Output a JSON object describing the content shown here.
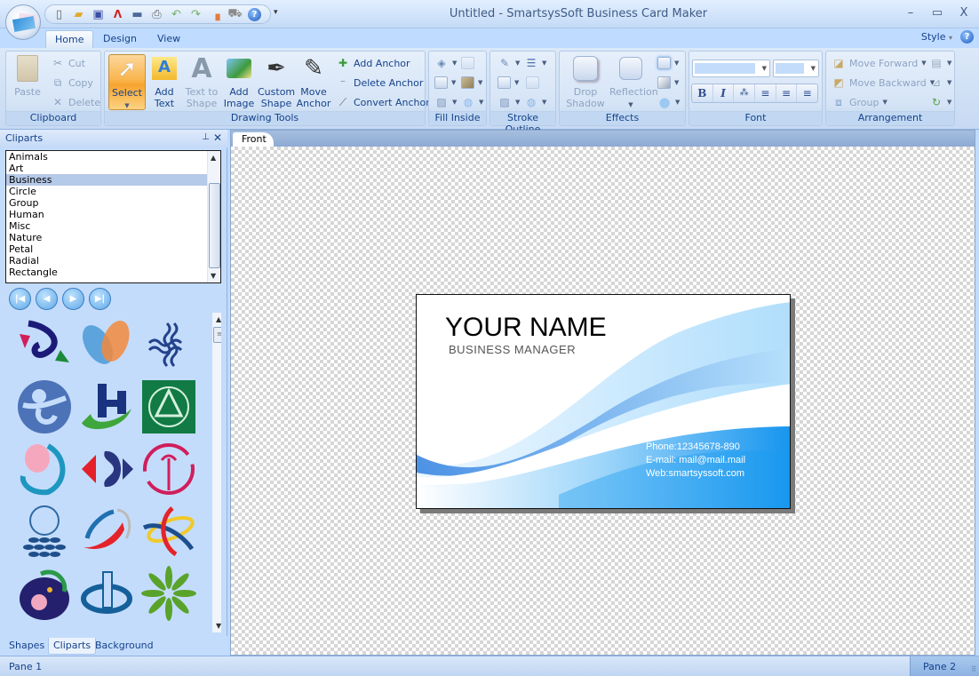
{
  "window": {
    "title": "Untitled - SmartsysSoft Business Card Maker",
    "minimize": "–",
    "maximize": "▭",
    "close": "X"
  },
  "quick_access": [
    {
      "name": "new-document-icon",
      "glyph": "🗋"
    },
    {
      "name": "open-folder-icon",
      "glyph": "📂"
    },
    {
      "name": "save-icon",
      "glyph": "💾"
    },
    {
      "name": "pdf-icon",
      "glyph": "📄"
    },
    {
      "name": "image-export-icon",
      "glyph": "🖼"
    },
    {
      "name": "print-icon",
      "glyph": "🖨"
    },
    {
      "name": "undo-icon",
      "glyph": "↶"
    },
    {
      "name": "redo-icon",
      "glyph": "↷"
    },
    {
      "name": "eraser-icon",
      "glyph": "▴"
    },
    {
      "name": "cart-icon",
      "glyph": "🛒"
    },
    {
      "name": "help-icon",
      "glyph": "?"
    }
  ],
  "qat_more": "▾",
  "tabs": [
    {
      "label": "Home",
      "active": true
    },
    {
      "label": "Design",
      "active": false
    },
    {
      "label": "View",
      "active": false
    }
  ],
  "style_menu": {
    "label": "Style",
    "arrow": "▾",
    "help": "?"
  },
  "ribbon": {
    "clipboard": {
      "label": "Clipboard",
      "paste": "Paste",
      "cut": "Cut",
      "copy": "Copy",
      "delete": "Delete"
    },
    "drawing_tools": {
      "label": "Drawing Tools",
      "select": "Select",
      "add_text": "Add Text",
      "text_to_shape": "Text to Shape",
      "add_image": "Add Image",
      "custom_shape": "Custom Shape",
      "move_anchor": "Move Anchor",
      "add_anchor": "Add Anchor",
      "delete_anchor": "Delete Anchor",
      "convert_anchor": "Convert Anchor"
    },
    "fill_inside": {
      "label": "Fill Inside"
    },
    "stroke_outline": {
      "label": "Stroke Outline"
    },
    "effects": {
      "label": "Effects",
      "drop_shadow": "Drop Shadow",
      "reflection": "Reflection"
    },
    "font": {
      "label": "Font",
      "font_name": "",
      "font_size": "",
      "bold": "B",
      "italic": "I",
      "spacing": "⁂",
      "align_left": "≡",
      "align_center": "≡",
      "align_right": "≡"
    },
    "arrangement": {
      "label": "Arrangement",
      "move_forward": "Move Forward",
      "move_backward": "Move Backward",
      "group": "Group"
    }
  },
  "left_panel": {
    "title": "Cliparts",
    "pin": "ᵖ",
    "close": "✕",
    "categories": [
      "Animals",
      "Art",
      "Business",
      "Circle",
      "Group",
      "Human",
      "Misc",
      "Nature",
      "Petal",
      "Radial",
      "Rectangle"
    ],
    "selected_category": "Business",
    "nav": {
      "first": "|◀",
      "prev": "◀",
      "next": "▶",
      "last": "▶|"
    },
    "bottom_tabs": [
      {
        "label": "Shapes",
        "active": false
      },
      {
        "label": "Cliparts",
        "active": true
      },
      {
        "label": "Background",
        "active": false
      }
    ]
  },
  "document": {
    "tab": "Front",
    "card": {
      "name": "YOUR NAME",
      "title": "BUSINESS  MANAGER",
      "phone": "Phone:12345678-890",
      "email": "E-mail: mail@mail.mail",
      "web": "Web:smartsyssoft.com"
    }
  },
  "status": {
    "left": "Pane 1",
    "right": "Pane 2"
  },
  "colors": {
    "ribbon_text": "#15428b",
    "select_active": "#f9b54f",
    "card_blue": "#1a9af0"
  }
}
